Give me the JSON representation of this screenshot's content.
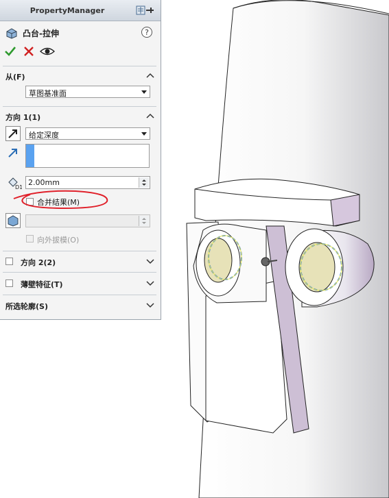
{
  "panel": {
    "title": "PropertyManager",
    "feature_title": "凸台-拉伸"
  },
  "from_section": {
    "label": "从(F)",
    "start_condition": "草图基准面"
  },
  "direction1": {
    "label": "方向 1(1)",
    "end_condition": "给定深度",
    "depth": "2.00mm",
    "merge_result_label": "合并结果(M)",
    "draft_outward_label": "向外拔模(O)"
  },
  "direction2": {
    "label": "方向 2(2)"
  },
  "thin_feature": {
    "label": "薄壁特征(T)"
  },
  "selected_contours": {
    "label": "所选轮廓(S)"
  },
  "colors": {
    "accent_blue": "#5aa2f0",
    "annotation_red": "#e0202a",
    "confirm_green": "#2e9a2e",
    "cancel_red": "#d02020"
  },
  "icons": [
    "pin-icon",
    "extrude-feature-icon",
    "help-icon",
    "ok-check-icon",
    "cancel-x-icon",
    "preview-eye-icon",
    "direction-arrow-icon",
    "direction-reverse-icon",
    "depth-dimension-icon",
    "draft-icon"
  ]
}
